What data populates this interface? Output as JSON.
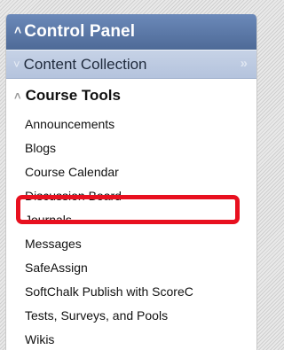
{
  "control_panel": {
    "title": "Control Panel",
    "content_collection": {
      "label": "Content Collection",
      "expand_glyph": "»"
    },
    "course_tools": {
      "title": "Course Tools",
      "items": [
        {
          "label": "Announcements"
        },
        {
          "label": "Blogs"
        },
        {
          "label": "Course Calendar"
        },
        {
          "label": "Discussion Board"
        },
        {
          "label": "Journals"
        },
        {
          "label": "Messages"
        },
        {
          "label": "SafeAssign"
        },
        {
          "label": "SoftChalk Publish with ScoreC"
        },
        {
          "label": "Tests, Surveys, and Pools"
        },
        {
          "label": "Wikis"
        }
      ]
    }
  },
  "colors": {
    "header_blue": "#5a77a6",
    "subheader_blue": "#bccae1",
    "highlight_red": "#e8101f"
  },
  "icons": {
    "collapse": "chevron-up-double-icon",
    "expand_down": "chevron-down-double-icon",
    "expand_right": "double-arrow-right-icon"
  }
}
